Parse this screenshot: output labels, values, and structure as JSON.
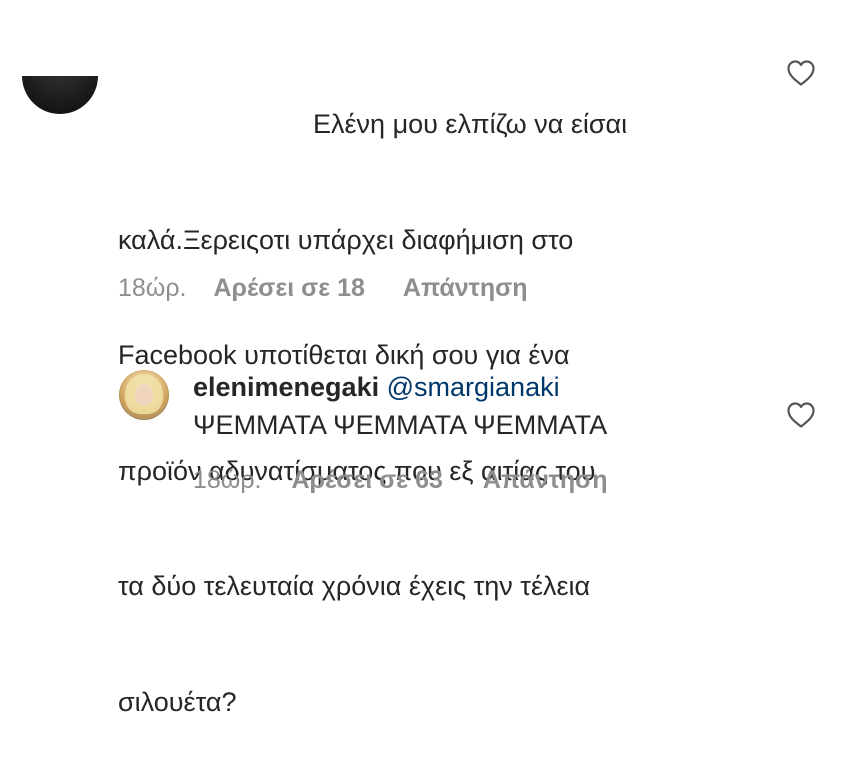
{
  "comment1": {
    "lines": [
      "Ελένη μου ελπίζω να είσαι",
      "καλά.Ξερειςοτι υπάρχει διαφήμιση στο",
      "Facebook υποτίθεται δική σου για ένα",
      "προϊόν αδυνατίσματος που εξ αιτίας του",
      "τα δύο τελευταία χρόνια έχεις την τέλεια",
      "σιλουέτα?"
    ],
    "time": "18ώρ.",
    "likes": "Αρέσει σε 18",
    "reply": "Απάντηση"
  },
  "comment2": {
    "username": "elenimenegaki",
    "mention": "@smargianaki",
    "text": "ΨΕΜΜΑΤΑ ΨΕΜΜΑΤΑ ΨΕΜΜΑΤΑ",
    "time": "18ώρ.",
    "likes": "Αρέσει σε 63",
    "reply": "Απάντηση"
  },
  "icons": {
    "like": "heart-outline-icon",
    "color_secondary": "#8e8e8e",
    "color_mention": "#00376b",
    "color_text": "#262626"
  }
}
